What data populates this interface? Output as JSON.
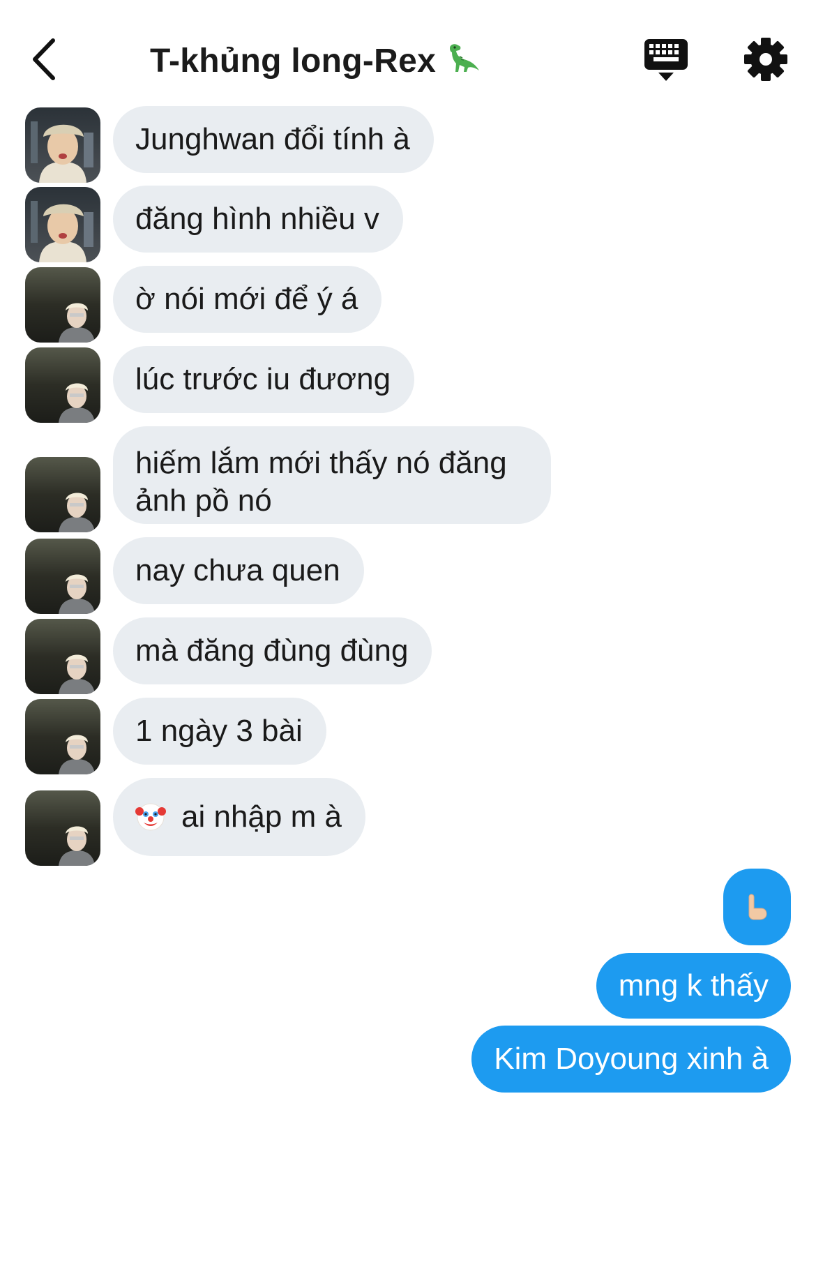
{
  "header": {
    "title": "T-khủng long-Rex",
    "back_icon": "chevron-left-icon",
    "keyboard_icon": "keyboard-icon",
    "settings_icon": "gear-icon"
  },
  "messages_in": [
    {
      "text": "Junghwan đổi tính à",
      "avatar": "user-a"
    },
    {
      "text": "đăng hình nhiều v",
      "avatar": "user-a"
    },
    {
      "text": "ờ nói mới để ý á",
      "avatar": "user-b"
    },
    {
      "text": "lúc trước iu đương",
      "avatar": "user-b"
    },
    {
      "text": "hiếm lắm mới thấy nó đăng ảnh pồ nó",
      "avatar": "user-b"
    },
    {
      "text": "nay chưa quen",
      "avatar": "user-b"
    },
    {
      "text": "mà đăng đùng đùng",
      "avatar": "user-b"
    },
    {
      "text": "1 ngày 3 bài",
      "avatar": "user-b"
    },
    {
      "text": "ai nhập m à",
      "avatar": "user-b",
      "emoji": "clown-face-icon"
    }
  ],
  "messages_out": [
    {
      "emoji": "pointing-hand-icon"
    },
    {
      "text": "mng k thấy"
    },
    {
      "text": "Kim Doyoung xinh à"
    }
  ],
  "colors": {
    "incoming_bubble": "#e9edf1",
    "outgoing_bubble": "#1d9bf0",
    "outgoing_text": "#ffffff"
  }
}
